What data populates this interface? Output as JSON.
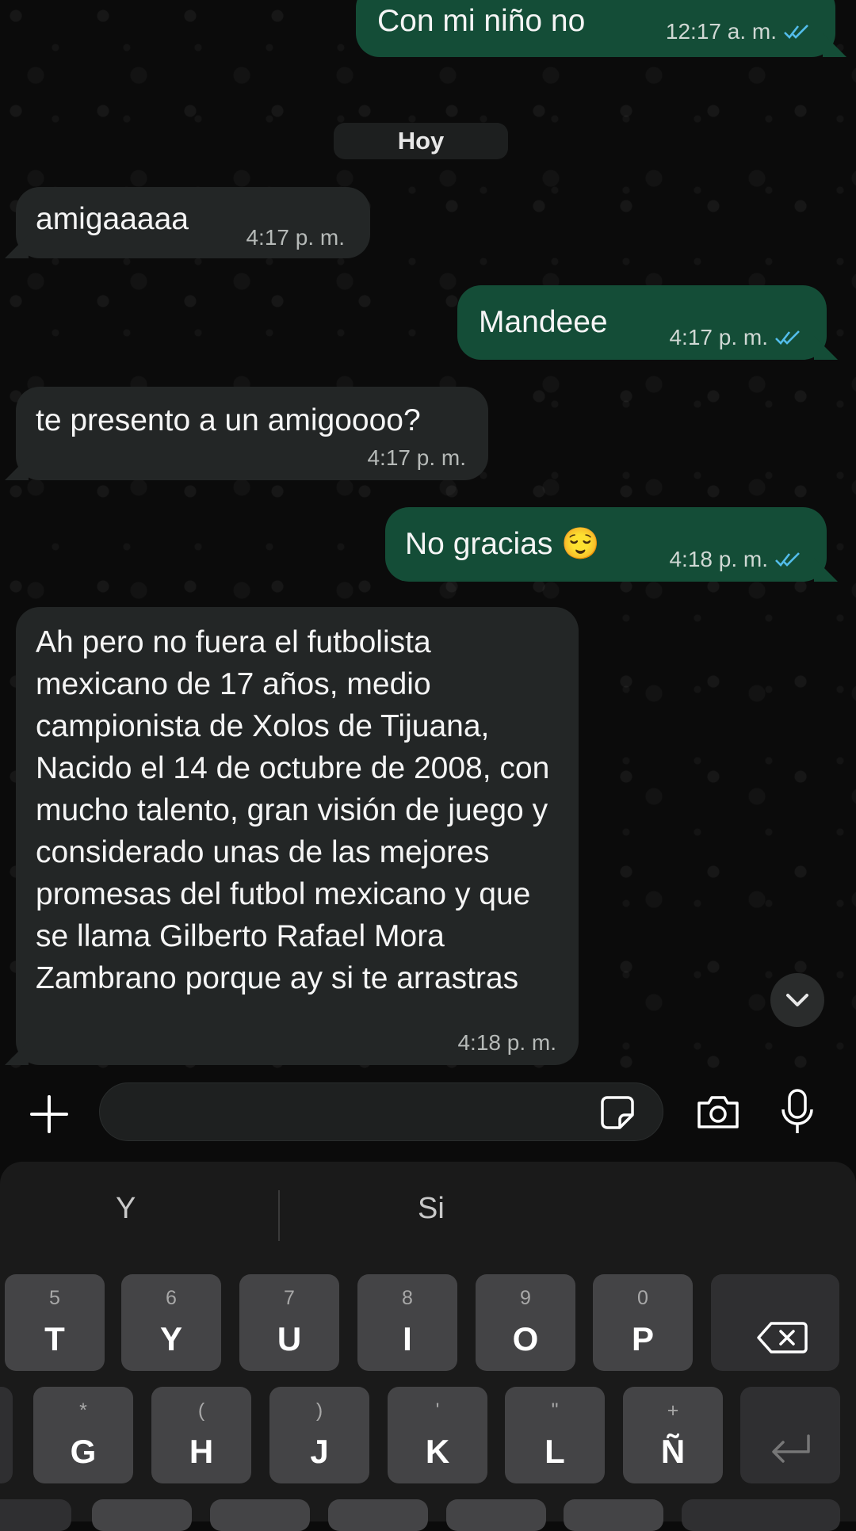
{
  "chat": {
    "date_separator": "Hoy",
    "messages": [
      {
        "direction": "out",
        "text": "Con mi niño no",
        "time": "12:17 a. m.",
        "status": "read"
      },
      {
        "direction": "in",
        "text": "amigaaaaa",
        "time": "4:17 p. m."
      },
      {
        "direction": "out",
        "text": "Mandeee",
        "time": "4:17 p. m.",
        "status": "read"
      },
      {
        "direction": "in",
        "text": "te presento a un amigoooo?",
        "time": "4:17 p. m."
      },
      {
        "direction": "out",
        "text": "No gracias 😌",
        "time": "4:18 p. m.",
        "status": "read"
      },
      {
        "direction": "in",
        "text": "Ah pero no fuera el futbolista mexicano de 17 años, medio campionista de Xolos de Tijuana, Nacido el 14 de octubre de 2008, con mucho talento, gran visión de juego y considerado unas de las mejores promesas del futbol mexicano y que se llama Gilberto Rafael Mora Zambrano porque ay si te arrastras",
        "time": "4:18 p. m."
      }
    ]
  },
  "icons": {
    "scroll_down": "chevron-down-icon",
    "attach": "plus-icon",
    "sticker": "sticker-icon",
    "camera": "camera-icon",
    "mic": "microphone-icon",
    "read_receipt": "double-check-icon"
  },
  "composer": {
    "placeholder": ""
  },
  "keyboard": {
    "suggestions": [
      "Y",
      "Si"
    ],
    "row1": [
      {
        "hint": "5",
        "letter": "T"
      },
      {
        "hint": "6",
        "letter": "Y"
      },
      {
        "hint": "7",
        "letter": "U"
      },
      {
        "hint": "8",
        "letter": "I"
      },
      {
        "hint": "9",
        "letter": "O"
      },
      {
        "hint": "0",
        "letter": "P"
      }
    ],
    "row2": [
      {
        "hint": "*",
        "letter": "G"
      },
      {
        "hint": "(",
        "letter": "H"
      },
      {
        "hint": ")",
        "letter": "J"
      },
      {
        "hint": "'",
        "letter": "K"
      },
      {
        "hint": "\"",
        "letter": "L"
      },
      {
        "hint": "+",
        "letter": "Ñ"
      }
    ]
  },
  "colors": {
    "outgoing_bubble": "#144d37",
    "incoming_bubble": "#232626",
    "read_tick": "#53bdeb",
    "background": "#0b0b0b",
    "key": "#444446"
  }
}
